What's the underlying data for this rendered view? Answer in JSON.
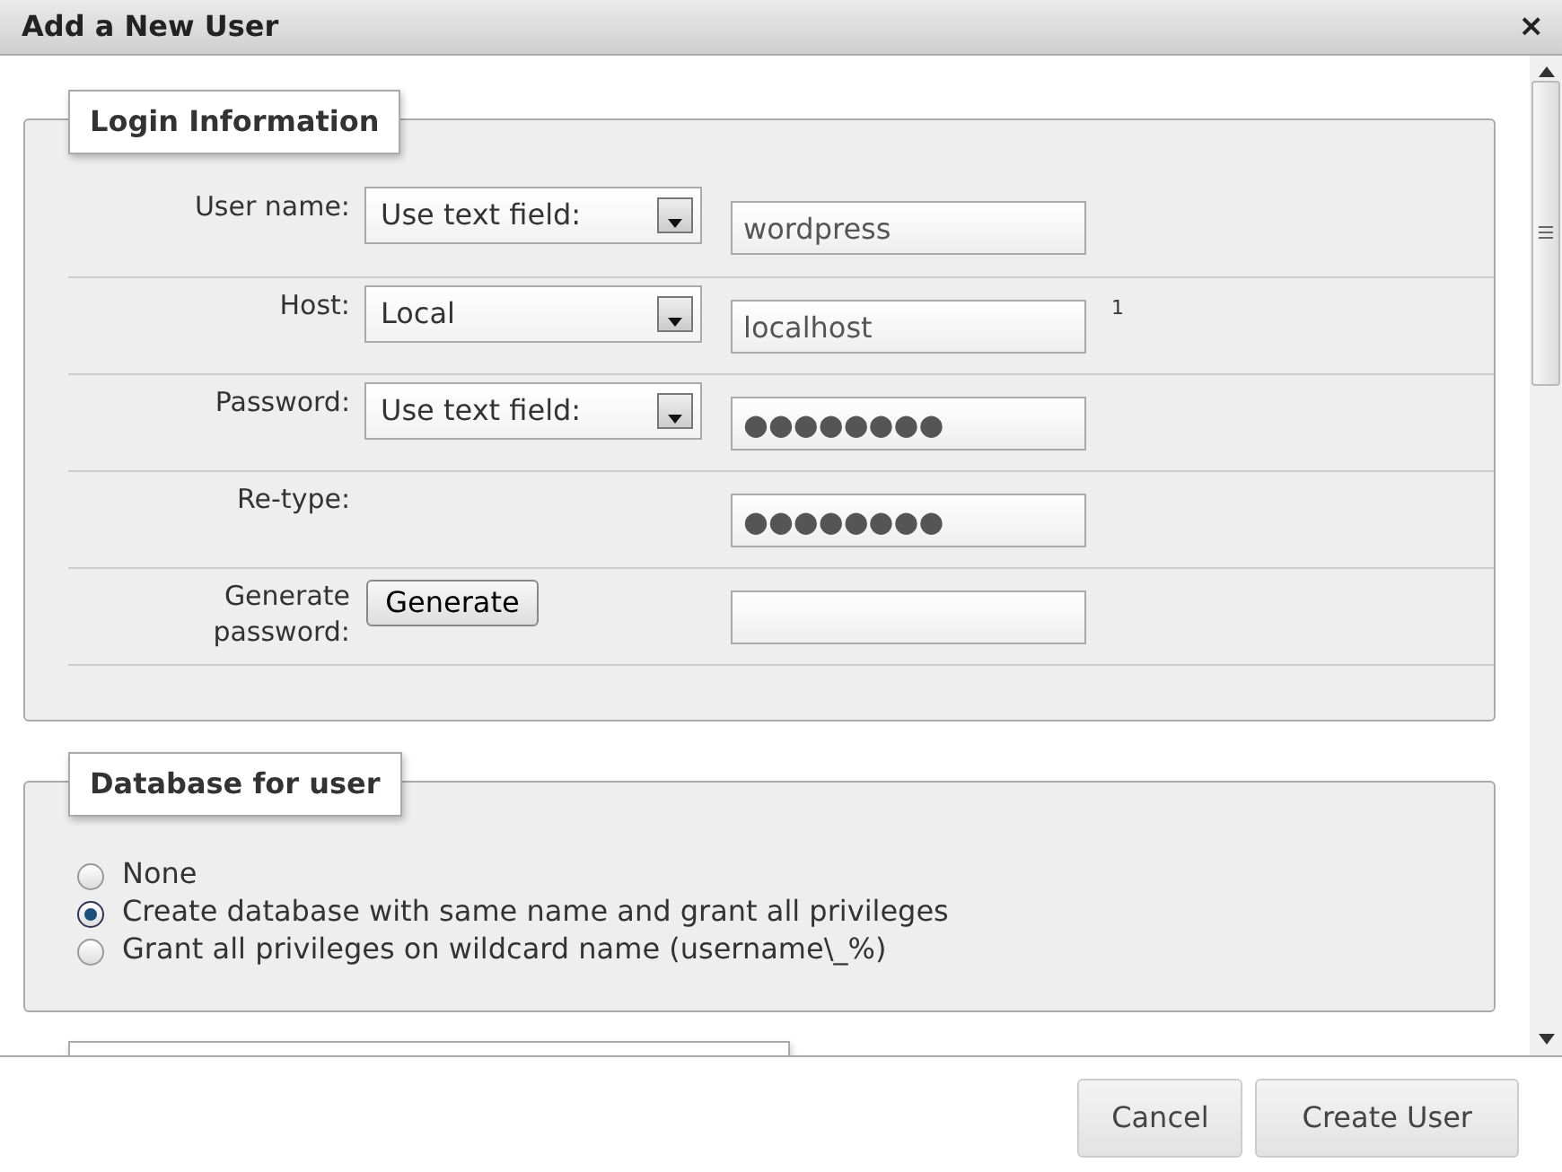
{
  "dialog": {
    "title": "Add a New User",
    "close": "×"
  },
  "login_information": {
    "legend": "Login Information",
    "rows": [
      {
        "label": "User name:",
        "kind": "select",
        "control": "Use text field:",
        "value": "wordpress"
      },
      {
        "label": "Host:",
        "kind": "select",
        "control": "Local",
        "value": "localhost",
        "note": "1"
      },
      {
        "label": "Password:",
        "kind": "select",
        "control": "Use text field:",
        "value": "●●●●●●●●"
      },
      {
        "label": "Re-type:",
        "kind": "plain",
        "value": "●●●●●●●●"
      },
      {
        "label": "Generate password:",
        "kind": "button",
        "control": "Generate"
      }
    ]
  },
  "database_for_user": {
    "legend": "Database for user",
    "options": [
      {
        "label": "None",
        "selected": false
      },
      {
        "label": "Create database with same name and grant all privileges",
        "selected": true
      },
      {
        "label": "Grant all privileges on wildcard name (username\\_%)",
        "selected": false
      }
    ]
  },
  "buttons": [
    "Cancel",
    "Create User"
  ]
}
